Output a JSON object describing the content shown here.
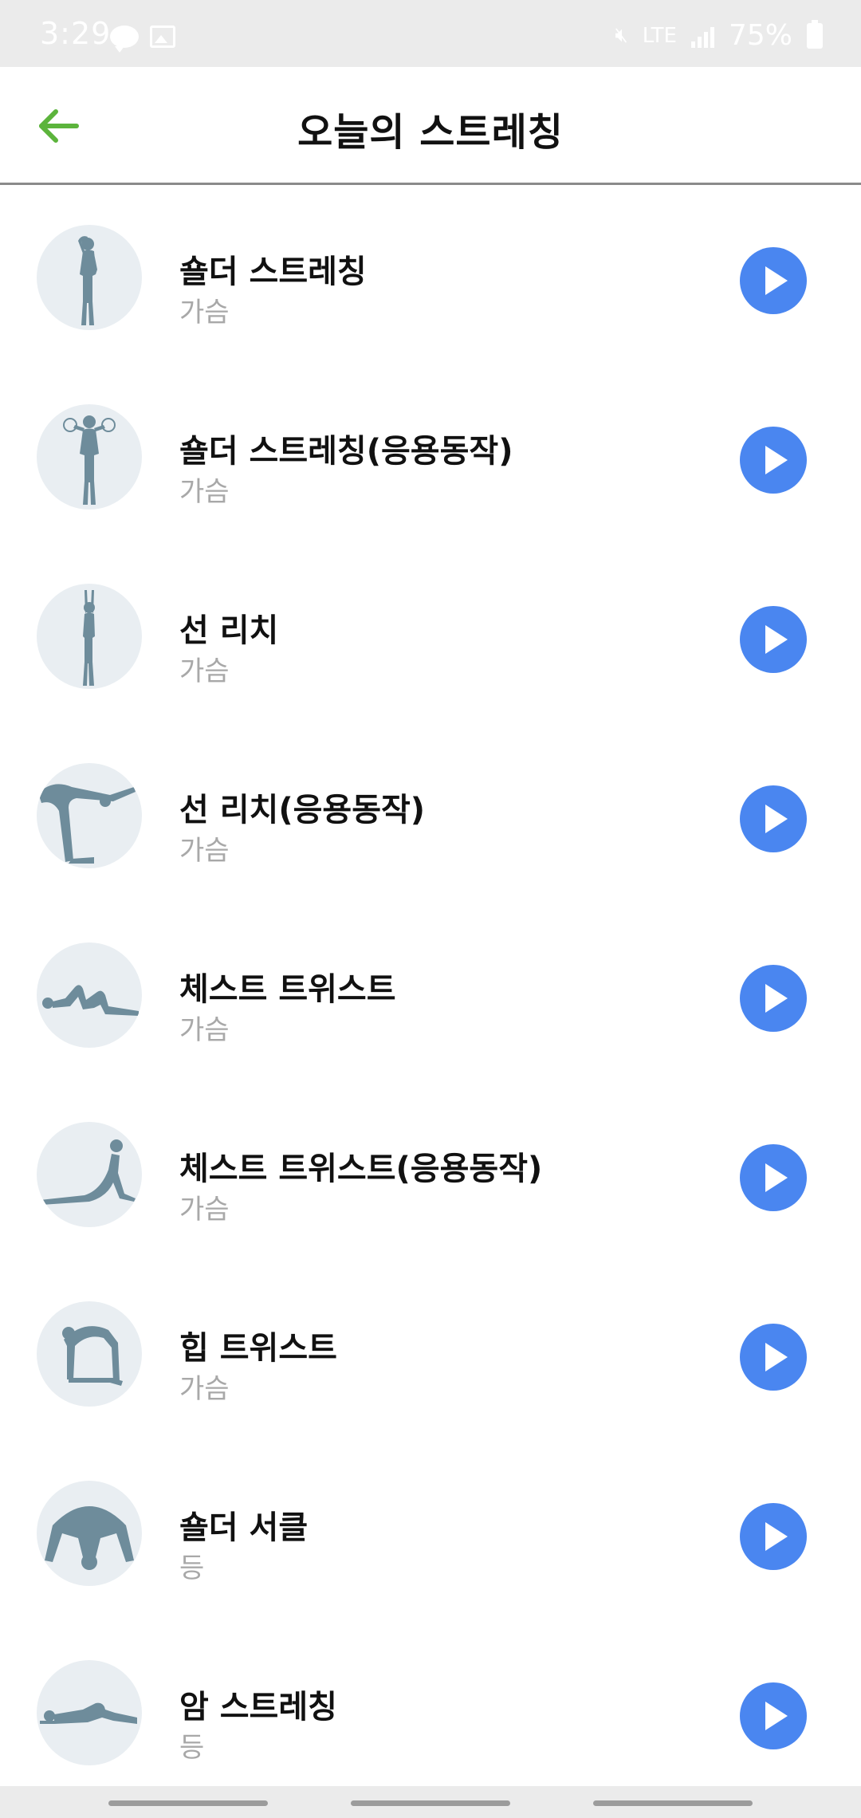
{
  "status_bar": {
    "time": "3:29",
    "network": "LTE",
    "battery": "75%"
  },
  "header": {
    "title": "오늘의 스트레칭",
    "back_icon": "arrow-left-icon",
    "accent_color": "#5cb43c"
  },
  "items": [
    {
      "title": "숄더 스트레칭",
      "category": "가슴",
      "pose": "standing-hand-on-head"
    },
    {
      "title": "숄더 스트레칭(응용동작)",
      "category": "가슴",
      "pose": "standing-arm-circles"
    },
    {
      "title": "선 리치",
      "category": "가슴",
      "pose": "standing-arms-up"
    },
    {
      "title": "선 리치(응용동작)",
      "category": "가슴",
      "pose": "forward-bend"
    },
    {
      "title": "체스트 트위스트",
      "category": "가슴",
      "pose": "lying-twist"
    },
    {
      "title": "체스트 트위스트(응용동작)",
      "category": "가슴",
      "pose": "cobra"
    },
    {
      "title": "힙 트위스트",
      "category": "가슴",
      "pose": "camel"
    },
    {
      "title": "숄더 서클",
      "category": "등",
      "pose": "kneeling-forward"
    },
    {
      "title": "암 스트레칭",
      "category": "등",
      "pose": "lying-side"
    }
  ],
  "colors": {
    "play_button": "#4a86f0",
    "avatar_bg": "#e9eef2",
    "figure": "#6e8c9b",
    "subtitle": "#a8a8a8"
  }
}
